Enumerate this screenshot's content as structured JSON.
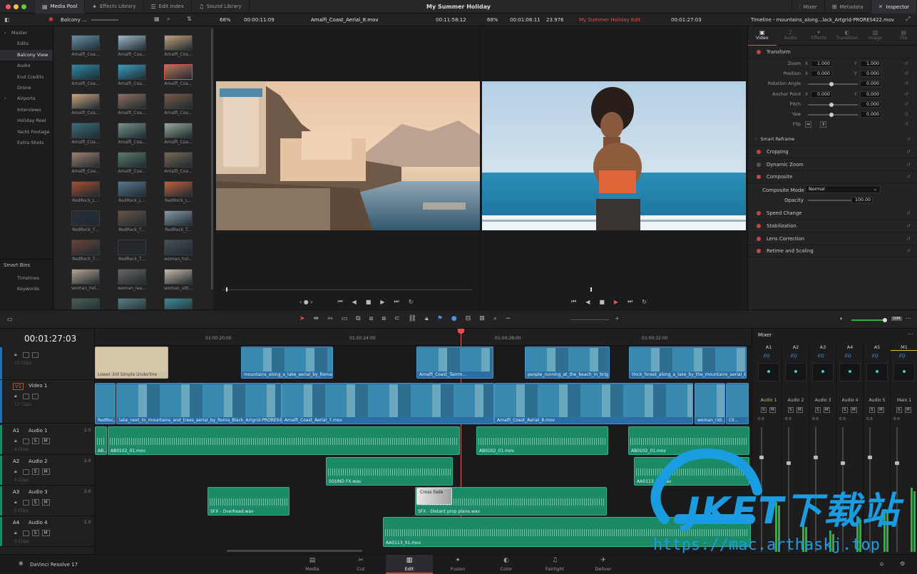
{
  "app": {
    "project_title": "My Summer Holiday",
    "version": "DaVinci Resolve 17"
  },
  "top_tabs": {
    "left": [
      {
        "label": "Media Pool",
        "icon": "media-pool-icon"
      },
      {
        "label": "Effects Library",
        "icon": "fx-icon"
      },
      {
        "label": "Edit Index",
        "icon": "list-icon"
      },
      {
        "label": "Sound Library",
        "icon": "music-icon"
      }
    ],
    "right": [
      {
        "label": "Mixer",
        "icon": "mixer-icon"
      },
      {
        "label": "Metadata",
        "icon": "tag-icon"
      },
      {
        "label": "Inspector",
        "icon": "inspector-icon"
      }
    ]
  },
  "media_pool": {
    "bin_name": "Balcony ...",
    "tree": [
      {
        "label": "Master",
        "expandable": true
      },
      {
        "label": "Edits"
      },
      {
        "label": "Balcony View",
        "selected": true
      },
      {
        "label": "Audio"
      },
      {
        "label": "End Credits"
      },
      {
        "label": "Drone"
      },
      {
        "label": "Airports",
        "expandable": true
      },
      {
        "label": "Interviews"
      },
      {
        "label": "Holiday Reel"
      },
      {
        "label": "Yacht Footage"
      },
      {
        "label": "Extra Shots"
      }
    ],
    "smart_bins_title": "Smart Bins",
    "smart_bins": [
      {
        "label": "Timelines"
      },
      {
        "label": "Keywords"
      }
    ],
    "clips": [
      "Amalfi_Coa...",
      "Amalfi_Coa...",
      "Amalfi_Coa...",
      "Amalfi_Coa...",
      "Amalfi_Coa...",
      "Amalfi_Coa...",
      "Amalfi_Coa...",
      "Amalfi_Coa...",
      "Amalfi_Coa...",
      "Amalfi_Coa...",
      "Amalfi_Coa...",
      "Amalfi_Coa...",
      "Amalfi_Coa...",
      "Amalfi_Coa...",
      "Amalfi_Coa...",
      "RedRock_L...",
      "RedRock_L...",
      "RedRock_L...",
      "RedRock_T...",
      "RedRock_T...",
      "RedRock_T...",
      "RedRock_T...",
      "RedRock_T...",
      "woman_hol...",
      "woman_hol...",
      "woman_lea...",
      "woman_sitt...",
      "",
      "",
      ""
    ],
    "clip_colors": [
      "#6a8fa8",
      "#a0b8c8",
      "#c4a27a",
      "#2e8aa8",
      "#3b9ec0",
      "#b8755c",
      "#caa57f",
      "#8e7060",
      "#7a5a48",
      "#3d6e7a",
      "#78908a",
      "#98a898",
      "#a08070",
      "#5a7a6a",
      "#7a6656",
      "#a84c30",
      "#58788e",
      "#c0603c",
      "#2a2e36",
      "#6a5446",
      "#8898a8",
      "#6a4438",
      "#2a2428",
      "#4a4e56",
      "#b8a490",
      "#6a6460",
      "#c8b8a8",
      "#4a5e54",
      "#5a7e84",
      "#3e8a96"
    ],
    "selected_index": 5
  },
  "source_viewer": {
    "zoom": "68%",
    "timecode": "00:00:11:09",
    "clip_name": "Amalfi_Coast_Aerial_8.mov",
    "duration": "00:11:58:12"
  },
  "timeline_viewer": {
    "zoom": "68%",
    "timecode": "00:01:06:11",
    "fps": "23.976",
    "timeline_name": "My Summer Holiday Edit",
    "current_tc": "00:01:27:03"
  },
  "inspector": {
    "title": "Timeline - mountains_along...lack_Artgrid-PRORES422.mov",
    "tabs": [
      "Video",
      "Audio",
      "Effects",
      "Transition",
      "Image",
      "File"
    ],
    "transform_title": "Transform",
    "params": [
      {
        "label": "Zoom",
        "x": "1.000",
        "y": "1.000"
      },
      {
        "label": "Position",
        "x": "0.000",
        "y": "0.000"
      },
      {
        "label": "Rotation Angle",
        "single": "0.000"
      },
      {
        "label": "Anchor Point",
        "x": "0.000",
        "y": "0.000"
      },
      {
        "label": "Pitch",
        "single": "0.000"
      },
      {
        "label": "Yaw",
        "single": "0.000"
      },
      {
        "label": "Flip",
        "single": ""
      }
    ],
    "sections": [
      "Smart Reframe",
      "Cropping",
      "Dynamic Zoom",
      "Composite",
      "Speed Change",
      "Stabilization",
      "Lens Correction",
      "Retime and Scaling"
    ],
    "composite": {
      "mode_label": "Composite Mode",
      "mode_value": "Normal",
      "opacity_label": "Opacity",
      "opacity_value": "100.00"
    }
  },
  "timeline": {
    "timecode": "00:01:27:03",
    "ruler": [
      "01:00:20:00",
      "01:00:24:00",
      "01:00:28:00",
      "01:00:32:00"
    ],
    "tracks": [
      {
        "id": "",
        "name": "",
        "clips_count": "11 Clips"
      },
      {
        "id": "V1",
        "name": "Video 1",
        "clips_count": "17 Clips"
      },
      {
        "id": "A1",
        "name": "Audio 1",
        "level": "2.0",
        "clips_count": "8 Clips"
      },
      {
        "id": "A2",
        "name": "Audio 2",
        "level": "2.0",
        "clips_count": "5 Clips"
      },
      {
        "id": "A3",
        "name": "Audio 3",
        "level": "2.0",
        "clips_count": "5 Clips"
      },
      {
        "id": "A4",
        "name": "Audio 4",
        "level": "2.0",
        "clips_count": "3 Clips"
      }
    ],
    "clips_v2": [
      "Lower 3rd Simple Underline",
      "mountains_along_a_lake_aerial_by_Roma...",
      "Amalfi_Coast_Taorm...",
      "people_running_at_the_beach_in_brig...",
      "thick_forest_along_a_lake_by_the_mountains_aerial_b..."
    ],
    "clips_v1": [
      "RedRoc...",
      "lake_next_to_mountains_and_trees_aerial_by_Roma_Black_Artgrid-PRORES4...",
      "Amalfi_Coast_Aerial_7.mov",
      "Amalfi_Coast_Aerial_8.mov",
      "woman_ridi...",
      "Cli..."
    ],
    "clips_a1": [
      "AB...",
      "AB0102_01.mov",
      "AB0102_01.mov",
      "AB0102_01.mov"
    ],
    "clips_a2": [
      "SOUND FX.wav",
      "AA0113_01.wav"
    ],
    "clips_a3": [
      "SFX - Overhead.wav",
      "SFX - Distant prop plane.wav"
    ],
    "crossfade": "Cross Fade",
    "clips_a4": [
      "AA0113_01.mov"
    ]
  },
  "mixer": {
    "title": "Mixer",
    "channels": [
      {
        "id": "A1",
        "name": "Audio 1"
      },
      {
        "id": "A2",
        "name": "Audio 2"
      },
      {
        "id": "A3",
        "name": "Audio 3"
      },
      {
        "id": "A4",
        "name": "Audio 4"
      },
      {
        "id": "A5",
        "name": "Audio 5"
      },
      {
        "id": "M1",
        "name": "Main 1"
      }
    ],
    "eq": "EQ",
    "level": "0.0"
  },
  "pages": [
    {
      "label": "Media",
      "icon": "media-page-icon"
    },
    {
      "label": "Cut",
      "icon": "cut-page-icon"
    },
    {
      "label": "Edit",
      "icon": "edit-page-icon",
      "active": true
    },
    {
      "label": "Fusion",
      "icon": "fusion-page-icon"
    },
    {
      "label": "Color",
      "icon": "color-page-icon"
    },
    {
      "label": "Fairlight",
      "icon": "fairlight-page-icon"
    },
    {
      "label": "Deliver",
      "icon": "deliver-page-icon"
    }
  ],
  "watermark": {
    "text": "JKET下载站",
    "url": "https://mac.arthaskj.top"
  }
}
